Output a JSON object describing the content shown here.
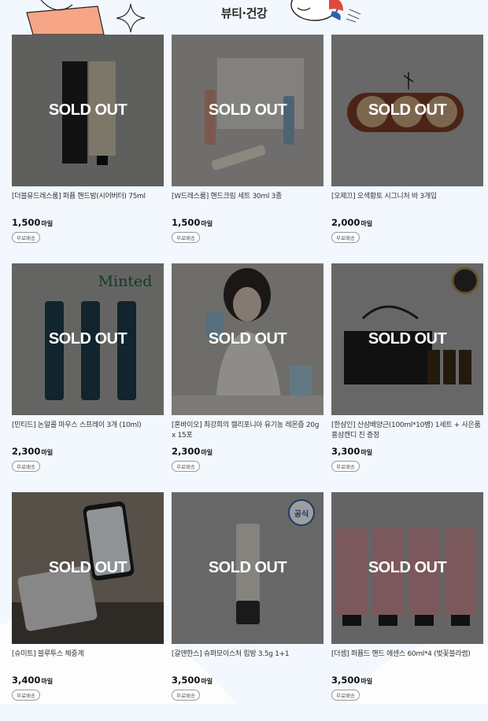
{
  "header": {
    "title": "뷰티·건강"
  },
  "sold_out_label": "SOLD OUT",
  "currency_unit": "마일",
  "products": [
    {
      "name": "[더블유드레스룸] 퍼퓸 핸드밤(시어버터) 75ml",
      "price": "1,500",
      "badge": "무료배송",
      "image": "shea-butter-hand-balm"
    },
    {
      "name": "[W드레스룸] 핸드크림 세트 30ml 3종",
      "price": "1,500",
      "badge": "무료배송",
      "image": "hand-cream-set"
    },
    {
      "name": "[오제끄] 오색황토 시그니처 바 3개입",
      "price": "2,000",
      "badge": "무료배송",
      "image": "ocher-soap-bars"
    },
    {
      "name": "[민티드] 논알콜 마우스 스프레이 3개 (10ml)",
      "price": "2,300",
      "badge": "무료배송",
      "image": "minted-mouth-spray",
      "brand_text": "Minted"
    },
    {
      "name": "[혼바이오] 최강희의 캘리포니아 유기농 레몬즙 20g x 15포",
      "price": "2,300",
      "badge": "무료배송",
      "image": "lemon-juice-model"
    },
    {
      "name": "[한삼인] 산삼배양근(100ml*10병) 1세트 + 사은품 홍삼캔디 진 증정",
      "price": "3,300",
      "badge": "무료배송",
      "image": "ginseng-gift-set"
    },
    {
      "name": "[슈미트] 블루투스 체중계",
      "price": "3,400",
      "badge": "무료배송",
      "image": "bluetooth-scale"
    },
    {
      "name": "[갈앤한스] 슈퍼모이스처 립밤 3.5g 1+1",
      "price": "3,500",
      "badge": "무료배송",
      "image": "lip-balm",
      "stamp_text": "공식"
    },
    {
      "name": "[더셈] 퍼퓸드 핸드 에센스 60ml*4 (벚꽃블라썸)",
      "price": "3,500",
      "badge": "무료배송",
      "image": "hand-essence-set"
    }
  ]
}
